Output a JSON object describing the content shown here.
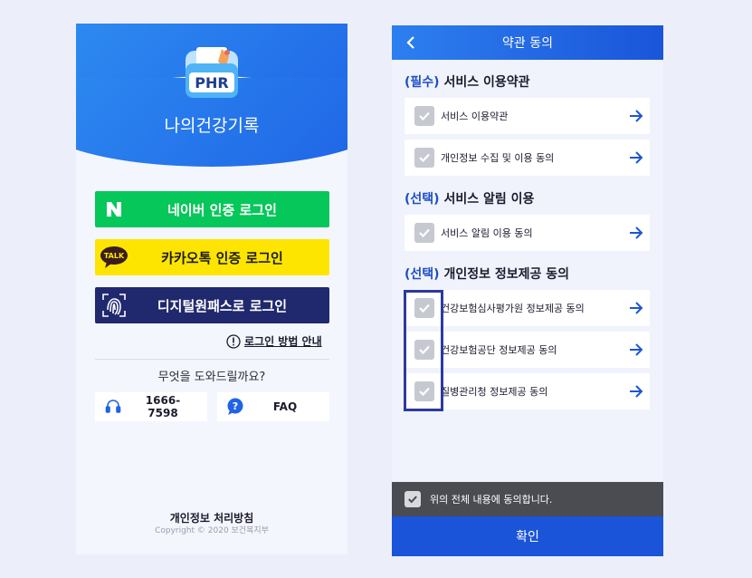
{
  "login_screen": {
    "logo_text": "PHR",
    "app_title": "나의건강기록",
    "naver_button": "네이버 인증 로그인",
    "kakao_button": "카카오톡 인증 로그인",
    "kakao_badge": "TALK",
    "digital_button": "디지털원패스로 로그인",
    "login_guide": "로그인 방법 안내",
    "help_question": "무엇을 도와드릴까요?",
    "phone_number": "1666-7598",
    "faq_label": "FAQ",
    "faq_icon_glyph": "?",
    "privacy_policy": "개인정보 처리방침",
    "copyright": "Copyright © 2020 보건복지부",
    "colors": {
      "naver": "#06c75a",
      "kakao": "#fee500",
      "digital": "#20286e",
      "brand": "#1f63e6"
    }
  },
  "terms_screen": {
    "title": "약관 동의",
    "sections": [
      {
        "tag": "(필수)",
        "title": "서비스 이용약관",
        "items": [
          "서비스 이용약관",
          "개인정보 수집 및 이용 동의"
        ]
      },
      {
        "tag": "(선택)",
        "title": "서비스 알림 이용",
        "items": [
          "서비스 알림 이용 동의"
        ]
      },
      {
        "tag": "(선택)",
        "title": "개인정보 정보제공 동의",
        "items": [
          "건강보험심사평가원 정보제공 동의",
          "건강보험공단 정보제공 동의",
          "질병관리청 정보제공 동의"
        ]
      }
    ],
    "agree_all": "위의 전체 내용에 동의합니다.",
    "confirm_button": "확인",
    "colors": {
      "topbar": "#1a55d9",
      "highlight": "#2c3a9e"
    }
  }
}
